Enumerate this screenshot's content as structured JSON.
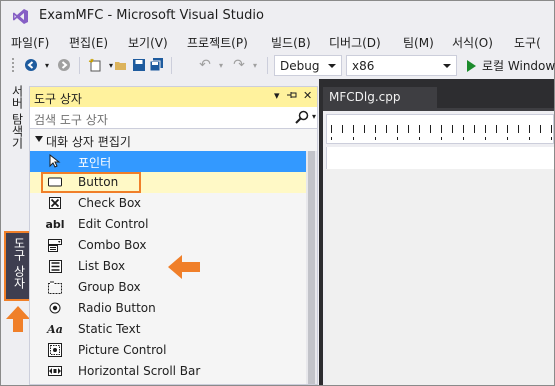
{
  "window": {
    "title": "ExamMFC - Microsoft Visual Studio"
  },
  "menu": [
    {
      "label": "파일(F)"
    },
    {
      "label": "편집(E)"
    },
    {
      "label": "보기(V)"
    },
    {
      "label": "프로젝트(P)"
    },
    {
      "label": "빌드(B)"
    },
    {
      "label": "디버그(D)"
    },
    {
      "label": "팀(M)"
    },
    {
      "label": "서식(O)"
    },
    {
      "label": "도구("
    }
  ],
  "toolbar": {
    "config_value": "Debug",
    "platform_value": "x86",
    "run_label": "로컬 Window"
  },
  "side_tabs": {
    "server_explorer": "서버 탐색기",
    "toolbox": "도구 상자"
  },
  "toolbox": {
    "title": "도구 상자",
    "header_controls": "▾ ‑ᴖ ✕",
    "search_placeholder": "검색 도구 상자",
    "group_label": "대화 상자 편집기",
    "items": [
      {
        "label": "포인터",
        "icon": "pointer-icon"
      },
      {
        "label": "Button",
        "icon": "button-icon"
      },
      {
        "label": "Check Box",
        "icon": "checkbox-icon"
      },
      {
        "label": "Edit Control",
        "icon": "edit-control-icon"
      },
      {
        "label": "Combo Box",
        "icon": "combo-box-icon"
      },
      {
        "label": "List Box",
        "icon": "list-box-icon"
      },
      {
        "label": "Group Box",
        "icon": "group-box-icon"
      },
      {
        "label": "Radio Button",
        "icon": "radio-button-icon"
      },
      {
        "label": "Static Text",
        "icon": "static-text-icon"
      },
      {
        "label": "Picture Control",
        "icon": "picture-control-icon"
      },
      {
        "label": "Horizontal Scroll Bar",
        "icon": "hscrollbar-icon"
      }
    ],
    "icon_glyphs": {
      "edit_control": "abl",
      "static_text": "Aa"
    }
  },
  "editor": {
    "tab_label": "MFCDlg.cpp"
  },
  "colors": {
    "accent_orange": "#f07f29",
    "selection_blue": "#3399ff",
    "panel_header_yellow": "#fff29d",
    "run_green": "#1c8b2c"
  }
}
